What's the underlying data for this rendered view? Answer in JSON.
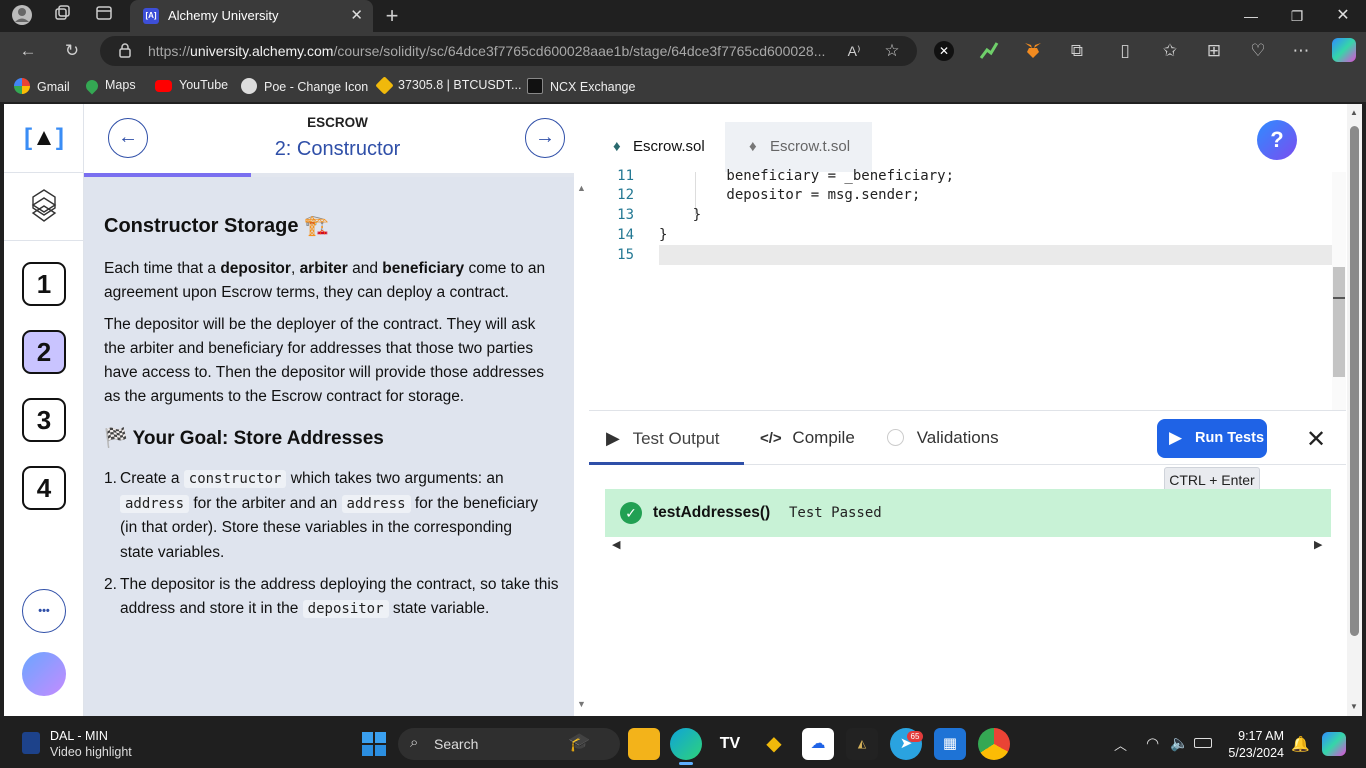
{
  "browser": {
    "tab_title": "Alchemy University",
    "tab_favicon_text": "[A]",
    "url_prefix": "https://",
    "url_domain": "university.alchemy.com",
    "url_path": "/course/solidity/sc/64dce3f7765cd600028aae1b/stage/64dce3f7765cd600028...",
    "bookmarks": [
      "Gmail",
      "Maps",
      "YouTube",
      "Poe - Change Icon",
      "37305.8 | BTCUSDT...",
      "NCX Exchange"
    ],
    "extension_badge": "65"
  },
  "nav": {
    "logo_text": "[A]",
    "steps": [
      "1",
      "2",
      "3",
      "4"
    ],
    "active_step": "2",
    "more_label": "•••"
  },
  "lesson": {
    "module": "ESCROW",
    "stage_title": "2: Constructor",
    "heading": "Constructor Storage 🏗️",
    "para1_before": "Each time that a ",
    "para1_b1": "depositor",
    "para1_sep1": ", ",
    "para1_b2": "arbiter",
    "para1_sep2": " and ",
    "para1_b3": "beneficiary",
    "para1_after": " come to an agreement upon Escrow terms, they can deploy a contract.",
    "para2": "The depositor will be the deployer of the contract. They will ask the arbiter and beneficiary for addresses that those two parties have access to. Then the depositor will provide those addresses as the arguments to the Escrow contract for storage.",
    "goal_heading": "🏁 Your Goal: Store Addresses",
    "goal1_a": "Create a ",
    "goal1_code1": "constructor",
    "goal1_b": " which takes two arguments: an ",
    "goal1_code2": "address",
    "goal1_c": " for the arbiter and an ",
    "goal1_code3": "address",
    "goal1_d": " for the beneficiary (in that order). Store these variables in the corresponding state variables.",
    "goal2_a": "The depositor is the address deploying the contract, so take this address and store it in the ",
    "goal2_code": "depositor",
    "goal2_b": " state variable."
  },
  "editor": {
    "tabs": [
      "Escrow.sol",
      "Escrow.t.sol"
    ],
    "help_label": "?",
    "lines": [
      {
        "n": "11",
        "code": "        beneficiary = _beneficiary;"
      },
      {
        "n": "12",
        "code": "        depositor = msg.sender;"
      },
      {
        "n": "13",
        "code": "    }"
      },
      {
        "n": "14",
        "code": "}"
      },
      {
        "n": "15",
        "code": ""
      }
    ]
  },
  "output": {
    "tabs": [
      "Test Output",
      "Compile",
      "Validations"
    ],
    "run_label": "Run Tests",
    "shortcut": "CTRL + Enter",
    "test_name": "testAddresses()",
    "test_status": "Test Passed"
  },
  "taskbar": {
    "news_title": "DAL - MIN",
    "news_sub": "Video highlight",
    "search_placeholder": "Search",
    "time": "9:17 AM",
    "date": "5/23/2024",
    "telegram_badge": "65"
  },
  "colors": {
    "accent": "#1f63e6",
    "active_step": "#c9c4ff",
    "pass_bg": "#c8f2d6",
    "pass_icon": "#22a053",
    "progress": "#7a6ff0"
  }
}
